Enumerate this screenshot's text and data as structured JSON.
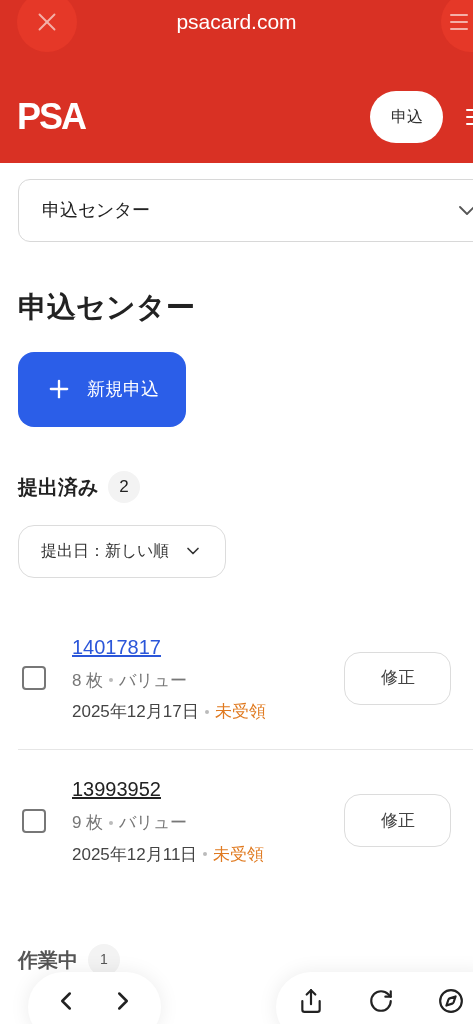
{
  "browser": {
    "address": "psacard.com"
  },
  "header": {
    "logo": "PSA",
    "apply_button": "申込"
  },
  "center_select": {
    "value": "申込センター"
  },
  "page_title": "申込センター",
  "new_button": "新規申込",
  "submitted": {
    "title": "提出済み",
    "count": "2",
    "sort": "提出日：新しい順",
    "orders": [
      {
        "number": "14017817",
        "link_blue": true,
        "checked": false,
        "cards": "8 枚",
        "service": "バリュー",
        "date": "2025年12月17日",
        "status": "未受領",
        "edit": "修正"
      },
      {
        "number": "13993952",
        "link_blue": false,
        "checked": false,
        "cards": "9 枚",
        "service": "バリュー",
        "date": "2025年12月11日",
        "status": "未受領",
        "edit": "修正"
      }
    ]
  },
  "in_progress": {
    "title": "作業中",
    "count": "1"
  }
}
